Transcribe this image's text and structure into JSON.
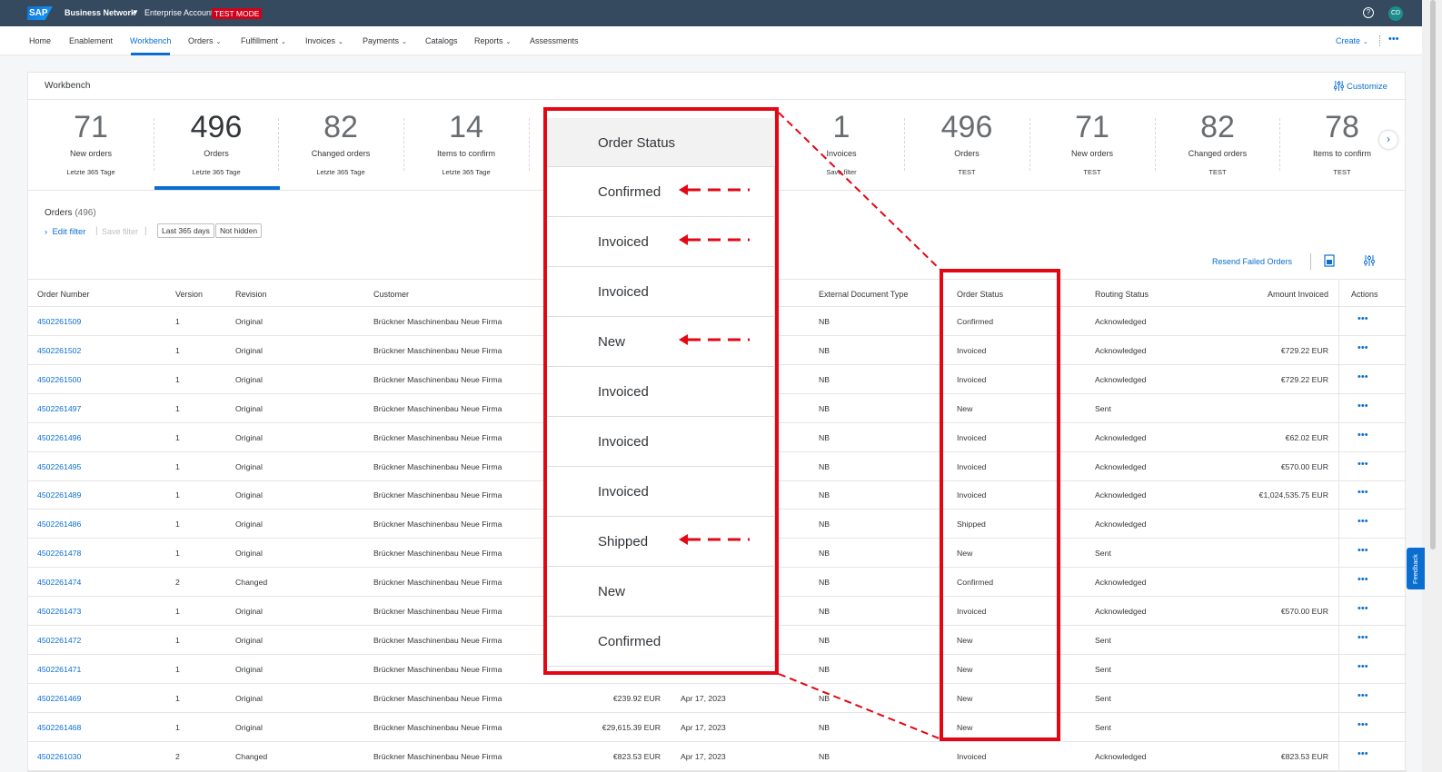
{
  "shell": {
    "logo": "SAP",
    "brand": "Business Network",
    "account": "Enterprise Account",
    "test_mode": "TEST MODE",
    "help": "?",
    "avatar": "CD"
  },
  "nav": {
    "items": [
      "Home",
      "Enablement",
      "Workbench",
      "Orders",
      "Fulfillment",
      "Invoices",
      "Payments",
      "Catalogs",
      "Reports",
      "Assessments"
    ],
    "create": "Create",
    "more": "•••"
  },
  "workbench": {
    "title": "Workbench",
    "customize": "Customize",
    "tiles": [
      {
        "num": "71",
        "label": "New orders",
        "sub": "Letzte 365 Tage"
      },
      {
        "num": "496",
        "label": "Orders",
        "sub": "Letzte 365 Tage"
      },
      {
        "num": "82",
        "label": "Changed orders",
        "sub": "Letzte 365 Tage"
      },
      {
        "num": "14",
        "label": "Items to confirm",
        "sub": "Letzte 365 Tage"
      },
      {
        "num": "1",
        "label": "Invoices",
        "sub": "Save filter"
      },
      {
        "num": "496",
        "label": "Orders",
        "sub": "TEST"
      },
      {
        "num": "71",
        "label": "New orders",
        "sub": "TEST"
      },
      {
        "num": "82",
        "label": "Changed orders",
        "sub": "TEST"
      },
      {
        "num": "78",
        "label": "Items to confirm",
        "sub": "TEST"
      }
    ]
  },
  "orders": {
    "title": "Orders",
    "count": "(496)",
    "edit_filter": "Edit filter",
    "save_filter": "Save filter",
    "chips": [
      "Last 365 days",
      "Not hidden"
    ],
    "resend": "Resend Failed Orders",
    "columns": {
      "order_number": "Order Number",
      "version": "Version",
      "revision": "Revision",
      "customer": "Customer",
      "ext_doc_type": "External Document Type",
      "order_status": "Order Status",
      "routing_status": "Routing Status",
      "amount_invoiced": "Amount Invoiced",
      "actions": "Actions"
    },
    "rows": [
      {
        "num": "4502261509",
        "ver": "1",
        "rev": "Original",
        "cust": "Brückner Maschinenbau Neue Firma",
        "amt": "",
        "date": "",
        "ext": "NB",
        "status": "Confirmed",
        "routing": "Acknowledged",
        "inv": ""
      },
      {
        "num": "4502261502",
        "ver": "1",
        "rev": "Original",
        "cust": "Brückner Maschinenbau Neue Firma",
        "amt": "",
        "date": "",
        "ext": "NB",
        "status": "Invoiced",
        "routing": "Acknowledged",
        "inv": "€729.22 EUR"
      },
      {
        "num": "4502261500",
        "ver": "1",
        "rev": "Original",
        "cust": "Brückner Maschinenbau Neue Firma",
        "amt": "",
        "date": "",
        "ext": "NB",
        "status": "Invoiced",
        "routing": "Acknowledged",
        "inv": "€729.22 EUR"
      },
      {
        "num": "4502261497",
        "ver": "1",
        "rev": "Original",
        "cust": "Brückner Maschinenbau Neue Firma",
        "amt": "",
        "date": "",
        "ext": "NB",
        "status": "New",
        "routing": "Sent",
        "inv": ""
      },
      {
        "num": "4502261496",
        "ver": "1",
        "rev": "Original",
        "cust": "Brückner Maschinenbau Neue Firma",
        "amt": "",
        "date": "",
        "ext": "NB",
        "status": "Invoiced",
        "routing": "Acknowledged",
        "inv": "€62.02 EUR"
      },
      {
        "num": "4502261495",
        "ver": "1",
        "rev": "Original",
        "cust": "Brückner Maschinenbau Neue Firma",
        "amt": "",
        "date": "",
        "ext": "NB",
        "status": "Invoiced",
        "routing": "Acknowledged",
        "inv": "€570.00 EUR"
      },
      {
        "num": "4502261489",
        "ver": "1",
        "rev": "Original",
        "cust": "Brückner Maschinenbau Neue Firma",
        "amt": "",
        "date": "",
        "ext": "NB",
        "status": "Invoiced",
        "routing": "Acknowledged",
        "inv": "€1,024,535.75 EUR"
      },
      {
        "num": "4502261486",
        "ver": "1",
        "rev": "Original",
        "cust": "Brückner Maschinenbau Neue Firma",
        "amt": "",
        "date": "",
        "ext": "NB",
        "status": "Shipped",
        "routing": "Acknowledged",
        "inv": ""
      },
      {
        "num": "4502261478",
        "ver": "1",
        "rev": "Original",
        "cust": "Brückner Maschinenbau Neue Firma",
        "amt": "",
        "date": "",
        "ext": "NB",
        "status": "New",
        "routing": "Sent",
        "inv": ""
      },
      {
        "num": "4502261474",
        "ver": "2",
        "rev": "Changed",
        "cust": "Brückner Maschinenbau Neue Firma",
        "amt": "",
        "date": "",
        "ext": "NB",
        "status": "Confirmed",
        "routing": "Acknowledged",
        "inv": ""
      },
      {
        "num": "4502261473",
        "ver": "1",
        "rev": "Original",
        "cust": "Brückner Maschinenbau Neue Firma",
        "amt": "",
        "date": "",
        "ext": "NB",
        "status": "Invoiced",
        "routing": "Acknowledged",
        "inv": "€570.00 EUR"
      },
      {
        "num": "4502261472",
        "ver": "1",
        "rev": "Original",
        "cust": "Brückner Maschinenbau Neue Firma",
        "amt": "",
        "date": "",
        "ext": "NB",
        "status": "New",
        "routing": "Sent",
        "inv": ""
      },
      {
        "num": "4502261471",
        "ver": "1",
        "rev": "Original",
        "cust": "Brückner Maschinenbau Neue Firma",
        "amt": "",
        "date": "",
        "ext": "NB",
        "status": "New",
        "routing": "Sent",
        "inv": ""
      },
      {
        "num": "4502261469",
        "ver": "1",
        "rev": "Original",
        "cust": "Brückner Maschinenbau Neue Firma",
        "amt": "€239.92 EUR",
        "date": "Apr 17, 2023",
        "ext": "NB",
        "status": "New",
        "routing": "Sent",
        "inv": ""
      },
      {
        "num": "4502261468",
        "ver": "1",
        "rev": "Original",
        "cust": "Brückner Maschinenbau Neue Firma",
        "amt": "€29,615.39 EUR",
        "date": "Apr 17, 2023",
        "ext": "NB",
        "status": "New",
        "routing": "Sent",
        "inv": ""
      },
      {
        "num": "4502261030",
        "ver": "2",
        "rev": "Changed",
        "cust": "Brückner Maschinenbau Neue Firma",
        "amt": "€823.53 EUR",
        "date": "Apr 17, 2023",
        "ext": "NB",
        "status": "Invoiced",
        "routing": "Acknowledged",
        "inv": "€823.53 EUR"
      }
    ]
  },
  "callout": {
    "header": "Order Status",
    "items": [
      {
        "label": "Confirmed",
        "arrow": true
      },
      {
        "label": "Invoiced",
        "arrow": true
      },
      {
        "label": "Invoiced",
        "arrow": false
      },
      {
        "label": "New",
        "arrow": true
      },
      {
        "label": "Invoiced",
        "arrow": false
      },
      {
        "label": "Invoiced",
        "arrow": false
      },
      {
        "label": "Invoiced",
        "arrow": false
      },
      {
        "label": "Shipped",
        "arrow": true
      },
      {
        "label": "New",
        "arrow": false
      },
      {
        "label": "Confirmed",
        "arrow": false
      }
    ],
    "highlight_color": "#e30613"
  },
  "feedback": "Feedback",
  "colors": {
    "shell": "#354a5f",
    "accent": "#0a6ed1",
    "test_badge": "#d0021b"
  }
}
